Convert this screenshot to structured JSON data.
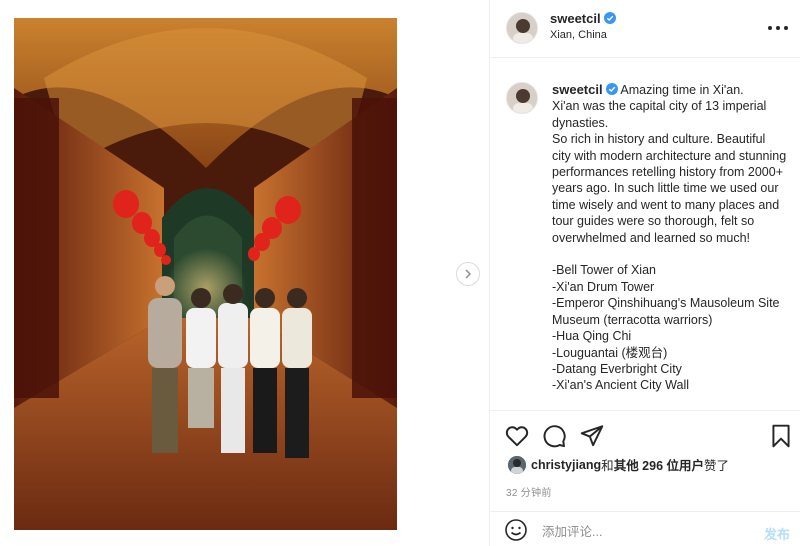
{
  "header": {
    "username": "sweetcil",
    "location": "Xian, China"
  },
  "caption": {
    "username": "sweetcil",
    "text": " Amazing time in Xi'an.\nXi'an was the capital city of 13 imperial dynasties.\nSo rich in history and culture. Beautiful city with modern architecture and stunning performances retelling history from 2000+ years ago. In such little time we used our time wisely and went to many places and tour guides were so thorough, felt so overwhelmed and learned so much!\n\n-Bell Tower of Xian\n-Xi'an Drum Tower\n-Emperor Qinshihuang's Mausoleum Site Museum (terracotta warriors)\n-Hua Qing Chi\n-Louguantai (楼观台)\n-Datang Everbright City\n-Xi'an's Ancient City Wall"
  },
  "likes": {
    "user": "christyjiang",
    "connector": " 和 ",
    "others": "其他 296 位用户",
    "suffix": " 赞了"
  },
  "time_ago": "32 分钟前",
  "comment": {
    "placeholder": "添加评论...",
    "post_label": "发布"
  },
  "icons": {
    "like": "heart-icon",
    "comment": "comment-icon",
    "share": "share-icon",
    "save": "bookmark-icon",
    "more": "more-horizontal-icon",
    "emoji": "emoji-icon",
    "next": "chevron-right-icon",
    "verified": "verified-badge-icon"
  },
  "colors": {
    "verified": "#3897f0",
    "post_disabled": "#b2dffc",
    "muted": "#8e8e8e",
    "lantern": "#e0241b"
  }
}
